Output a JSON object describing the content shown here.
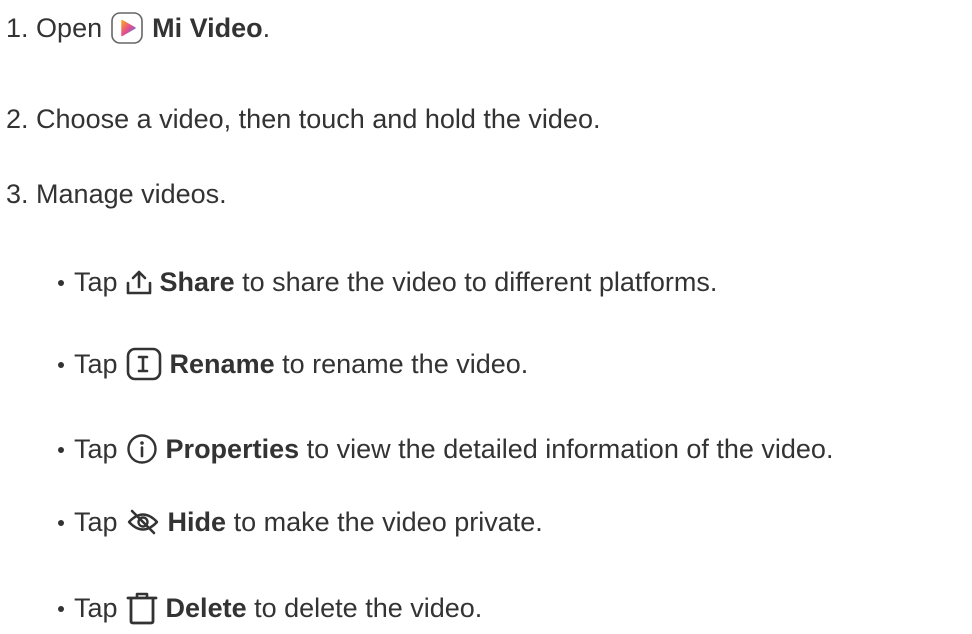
{
  "steps": [
    {
      "number": "1.",
      "before": "Open",
      "bold": "Mi Video",
      "after": ".",
      "icon": "mi-video-app-icon"
    },
    {
      "number": "2.",
      "text": "Choose a video, then touch and hold the video."
    },
    {
      "number": "3.",
      "text": "Manage videos."
    }
  ],
  "actions": [
    {
      "tap": "Tap",
      "icon": "share-icon",
      "bold": "Share",
      "rest": "to share the video to different platforms."
    },
    {
      "tap": "Tap",
      "icon": "rename-icon",
      "bold": "Rename",
      "rest": "to rename the video."
    },
    {
      "tap": "Tap",
      "icon": "info-icon",
      "bold": "Properties",
      "rest": "to view the detailed information of the video."
    },
    {
      "tap": "Tap",
      "icon": "hide-eye-icon",
      "bold": "Hide",
      "rest": "to make the video private."
    },
    {
      "tap": "Tap",
      "icon": "delete-trash-icon",
      "bold": "Delete",
      "rest": "to delete the video."
    }
  ],
  "colors": {
    "text": "#333333",
    "mi_video_icon_gradient": [
      "#f5a623",
      "#e94c8b",
      "#3a7bf7"
    ]
  }
}
